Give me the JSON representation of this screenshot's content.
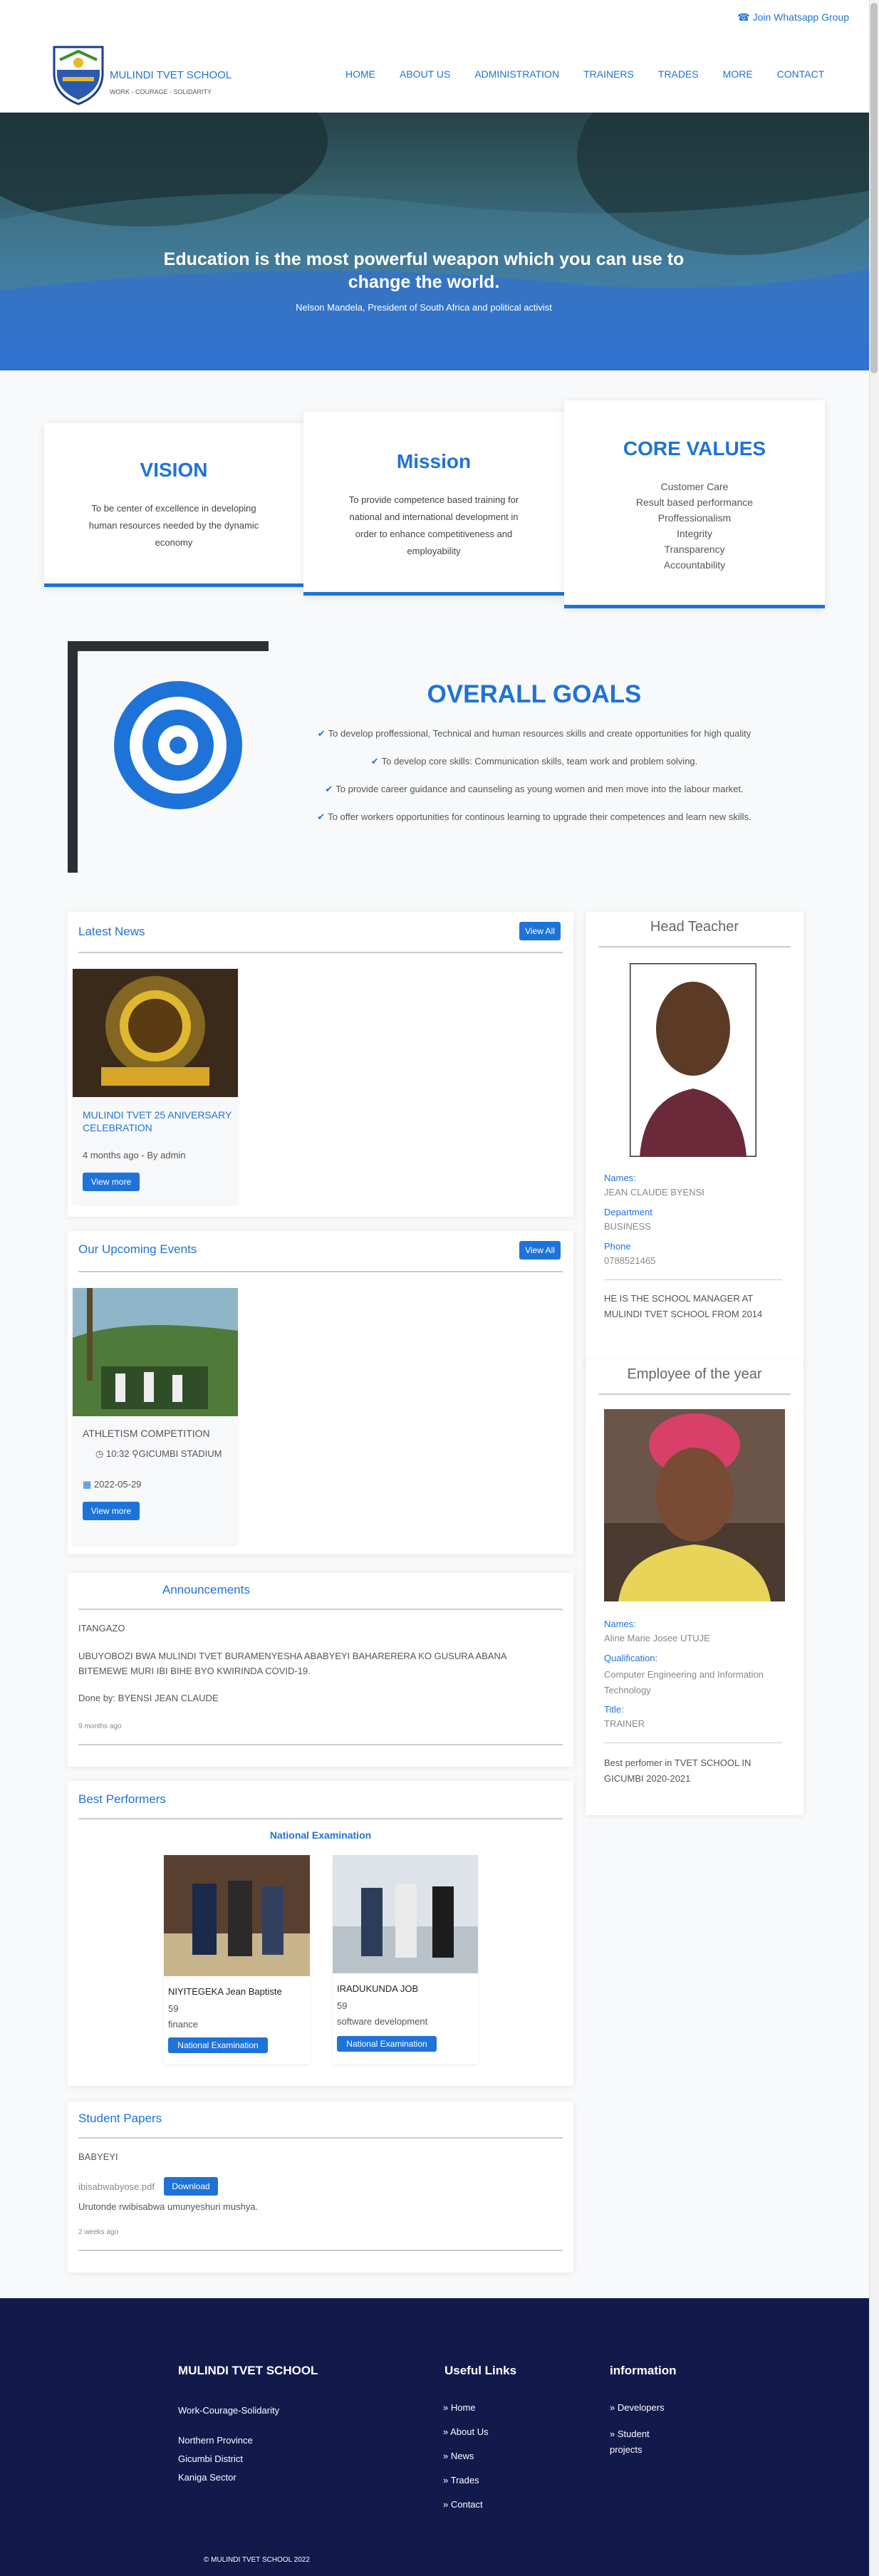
{
  "header": {
    "whatsapp": "Join Whatsapp Group",
    "school_name": "MULINDI TVET SCHOOL",
    "motto": "WORK - COURAGE - SOLIDARITY",
    "nav": [
      "HOME",
      "ABOUT US",
      "ADMINISTRATION",
      "TRAINERS",
      "TRADES",
      "MORE",
      "CONTACT"
    ]
  },
  "hero": {
    "quote": "Education is the most powerful weapon which you can use to change the world.",
    "author": "Nelson Mandela, President of South Africa and political activist"
  },
  "vision": {
    "title": "VISION",
    "text": "To be center of excellence in developing human resources needed by the dynamic economy"
  },
  "mission": {
    "title": "Mission",
    "text": "To provide competence based training for national and international development in order to enhance competitiveness and employability"
  },
  "core_values": {
    "title": "CORE VALUES",
    "items": [
      "Customer Care",
      "Result based performance",
      "Proffessionalism",
      "Integrity",
      "Transparency",
      "Accountability"
    ]
  },
  "goals": {
    "title": "OVERALL GOALS",
    "items": [
      "To develop proffessional, Technical and human resources skills and create opportunities for high quality",
      "To develop core skills: Communication skills, team work and problem solving.",
      "To provide career guidance and caunseling as young women and men move into the labour market.",
      "To offer workers opportunities for continous learning to upgrade their competences and learn new skills."
    ]
  },
  "news": {
    "title": "Latest News",
    "view_all": "View All",
    "item_title": "MULINDI TVET 25 ANIVERSARY CELEBRATION",
    "meta": "4 months ago - By admin",
    "more": "View more"
  },
  "events": {
    "title": "Our Upcoming Events",
    "view_all": "View All",
    "item_title": "ATHLETISM COMPETITION",
    "time": "10:32",
    "place": "GICUMBI STADIUM",
    "date": "2022-05-29",
    "more": "View more"
  },
  "announcements": {
    "title": "Announcements",
    "heading": "ITANGAZO",
    "body": "UBUYOBOZI BWA MULINDI TVET BURAMENYESHA ABABYEYI BAHARERERA KO GUSURA ABANA BITEMEWE MURI IBI BIHE BYO KWIRINDA COVID-19.",
    "signed": "Done by: BYENSI JEAN CLAUDE",
    "ago": "9 months ago"
  },
  "performers": {
    "title": "Best Performers",
    "subtitle": "National Examination",
    "people": [
      {
        "name": "NIYITEGEKA Jean Baptiste",
        "score": "59",
        "trade": "finance",
        "badge": "National Examination"
      },
      {
        "name": "IRADUKUNDA JOB",
        "score": "59",
        "trade": "software development",
        "badge": "National Examination"
      }
    ]
  },
  "papers": {
    "title": "Student Papers",
    "heading": "BABYEYI",
    "file": "ibisabwabyose.pdf",
    "download": "Download",
    "desc": "Urutonde rwibisabwa umunyeshuri mushya.",
    "ago": "2 weeks ago"
  },
  "head_teacher": {
    "title": "Head Teacher",
    "names_label": "Names:",
    "names": "JEAN CLAUDE BYENSI",
    "dept_label": "Department",
    "dept": "BUSINESS",
    "phone_label": "Phone",
    "phone": "0788521465",
    "note": "HE IS THE SCHOOL MANAGER AT MULINDI TVET SCHOOL FROM 2014"
  },
  "employee": {
    "title": "Employee of the year",
    "names_label": "Names:",
    "names": "Aline Marie Josee UTUJE",
    "qual_label": "Qualification:",
    "qual": "Computer Engineering and Information Technology",
    "title_label": "Title:",
    "role": "TRAINER",
    "note": "Best perfomer in TVET SCHOOL IN GICUMBI 2020-2021"
  },
  "footer": {
    "school": "MULINDI TVET SCHOOL",
    "motto": "Work-Courage-Solidarity",
    "address": [
      "Northern Province",
      "Gicumbi District",
      "Kaniga Sector"
    ],
    "useful_title": "Useful Links",
    "useful": [
      "Home",
      "About Us",
      "News",
      "Trades",
      "Contact"
    ],
    "info_title": "information",
    "info": [
      "Developers",
      "Student projects"
    ],
    "copyright": "© MULINDI TVET SCHOOL 2022"
  }
}
